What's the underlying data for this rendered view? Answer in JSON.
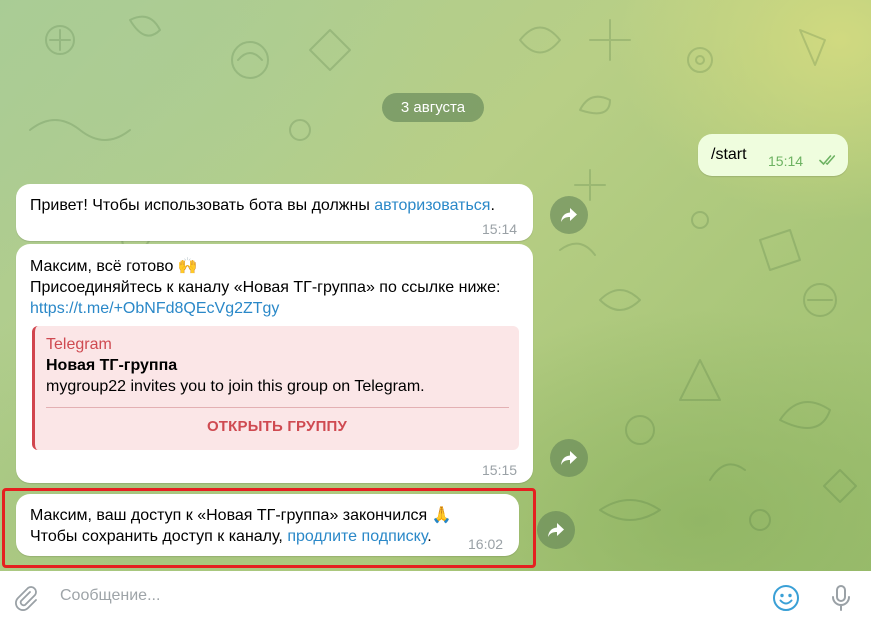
{
  "chat": {
    "date_label": "3 августа",
    "messages": [
      {
        "direction": "out",
        "text": "/start",
        "time": "15:14",
        "status": "read"
      },
      {
        "direction": "in",
        "text_before": "Привет! Чтобы использовать бота вы должны ",
        "link_text": "авторизоваться",
        "text_after": ".",
        "time": "15:14"
      },
      {
        "direction": "in",
        "line1": "Максим, всё готово 🙌",
        "line2": "Присоединяйтесь к каналу «Новая ТГ-группа» по ссылке ниже:",
        "link": "https://t.me/+ObNFd8QEcVg2ZTgy",
        "preview": {
          "site": "Telegram",
          "title": "Новая ТГ-группа",
          "description": "mygroup22 invites you to join this group on Telegram.",
          "button": "ОТКРЫТЬ ГРУППУ",
          "accent_color": "#cf4a51"
        },
        "time": "15:15"
      },
      {
        "direction": "in",
        "line1": "Максим, ваш доступ к «Новая ТГ-группа» закончился 🙏",
        "line2_before": "Чтобы сохранить доступ к каналу, ",
        "link_text": "продлите подписку",
        "line2_after": ".",
        "time": "16:02",
        "highlighted": true,
        "highlight_color": "#e52020"
      }
    ]
  },
  "composer": {
    "placeholder": "Сообщение...",
    "icons": [
      "paperclip-icon",
      "emoji-icon",
      "microphone-icon"
    ]
  },
  "colors": {
    "link": "#2a88c8",
    "outgoing_bubble": "#effdde",
    "read_check": "#6db262",
    "accent_icon": "#3aa0d6"
  }
}
